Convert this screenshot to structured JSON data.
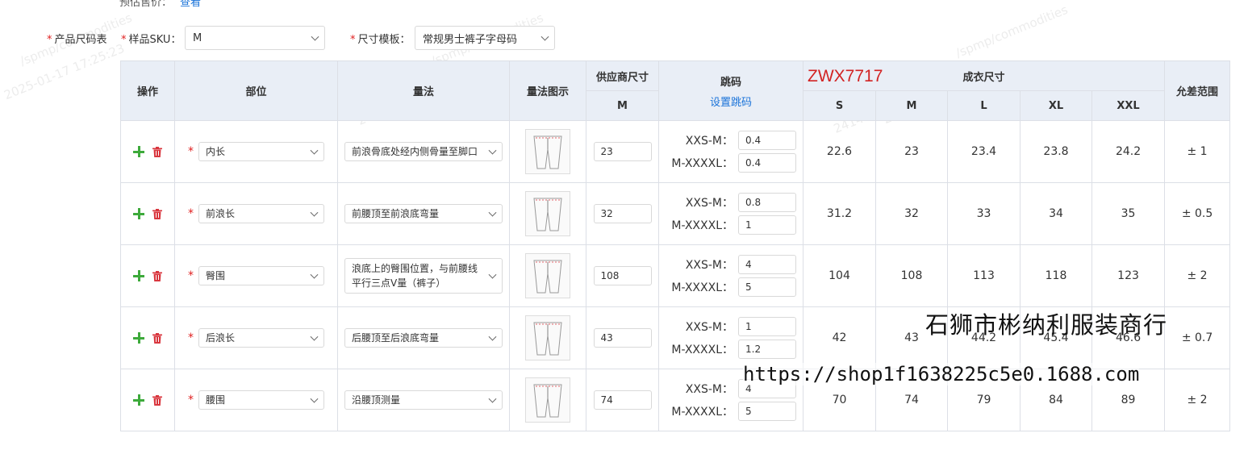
{
  "top_partial": {
    "label": "预估售价：",
    "link": "查看"
  },
  "form": {
    "size_table_label": "产品尺码表",
    "sku_label": "样品SKU：",
    "sku_value": "M",
    "template_label": "尺寸模板：",
    "template_value": "常规男士裤子字母码"
  },
  "table": {
    "headers": {
      "ops": "操作",
      "part": "部位",
      "method": "量法",
      "diagram": "量法图示",
      "supplier_size": "供应商尺寸",
      "supplier_size_col": "M",
      "jump": "跳码",
      "jump_link": "设置跳码",
      "finished_size": "成衣尺寸",
      "sizes": [
        "S",
        "M",
        "L",
        "XL",
        "XXL"
      ],
      "tolerance": "允差范围"
    },
    "jump_labels": {
      "a": "XXS-M：",
      "b": "M-XXXXL："
    },
    "rows": [
      {
        "part": "内长",
        "method": "前浪骨底处经内侧骨量至脚口",
        "supplier": "23",
        "jump_a": "0.4",
        "jump_b": "0.4",
        "sizes": [
          "22.6",
          "23",
          "23.4",
          "23.8",
          "24.2"
        ],
        "tol": "± 1"
      },
      {
        "part": "前浪长",
        "method": "前腰顶至前浪底弯量",
        "supplier": "32",
        "jump_a": "0.8",
        "jump_b": "1",
        "sizes": [
          "31.2",
          "32",
          "33",
          "34",
          "35"
        ],
        "tol": "± 0.5"
      },
      {
        "part": "臀围",
        "method": "浪底上的臀围位置，与前腰线平行三点V量（裤子）",
        "supplier": "108",
        "jump_a": "4",
        "jump_b": "5",
        "sizes": [
          "104",
          "108",
          "113",
          "118",
          "123"
        ],
        "tol": "± 2"
      },
      {
        "part": "后浪长",
        "method": "后腰顶至后浪底弯量",
        "supplier": "43",
        "jump_a": "1",
        "jump_b": "1.2",
        "sizes": [
          "42",
          "43",
          "44.2",
          "45.4",
          "46.6"
        ],
        "tol": "± 0.7"
      },
      {
        "part": "腰围",
        "method": "沿腰顶测量",
        "supplier": "74",
        "jump_a": "4",
        "jump_b": "5",
        "sizes": [
          "70",
          "74",
          "79",
          "84",
          "89"
        ],
        "tol": "± 2"
      }
    ]
  },
  "overlay": {
    "code": "ZWX7717",
    "shop_name": "石狮市彬纳利服装商行",
    "shop_url": "https://shop1f1638225c5e0.1688.com"
  },
  "watermarks": {
    "w1": "/spmp/commodities",
    "w2": "2025-01-17 17:25:23",
    "w3": "241403013391",
    "w4": "SPMP 2025-01-17"
  },
  "colors": {
    "link": "#1a73d9",
    "required": "#e02020",
    "plus": "#3daa3b",
    "trash": "#d9363e",
    "header_bg": "#e9eef6"
  }
}
